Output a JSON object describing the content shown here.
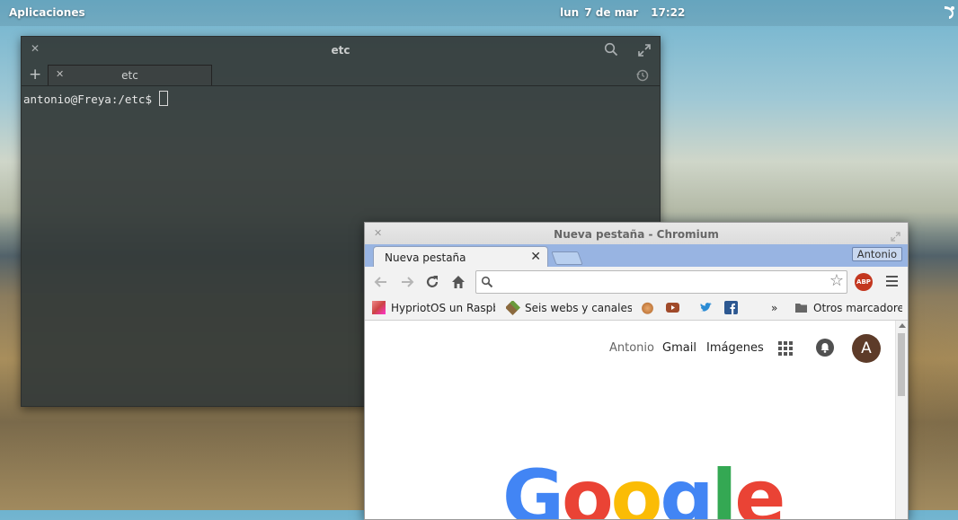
{
  "panel": {
    "applications_label": "Aplicaciones",
    "day": "lun",
    "date": "7 de mar",
    "time": "17:22"
  },
  "terminal": {
    "title": "etc",
    "tab_label": "etc",
    "prompt": "antonio@Freya:/etc$"
  },
  "chromium": {
    "window_title": "Nueva pestaña - Chromium",
    "tab_label": "Nueva pestaña",
    "profile_label": "Antonio",
    "omnibox_value": "",
    "abp_label": "ABP",
    "bookmarks": [
      {
        "label": "HypriotOS un Raspbia",
        "icon": "hypriot-favicon"
      },
      {
        "label": "Seis webs y canales de",
        "icon": "minecraft-favicon"
      },
      {
        "label": "",
        "icon": "reddit-favicon"
      },
      {
        "label": "",
        "icon": "youtube-icon"
      },
      {
        "label": "",
        "icon": "twitter-icon"
      },
      {
        "label": "",
        "icon": "facebook-icon"
      }
    ],
    "overflow_label": "»",
    "other_bookmarks_label": "Otros marcadores",
    "google_header": {
      "user_link": "Antonio",
      "gmail_link": "Gmail",
      "images_link": "Imágenes",
      "avatar_letter": "A"
    },
    "logo_text": "Google",
    "colors": {
      "tabstrip": "#98b4e2",
      "abp": "#c3371f",
      "avatar": "#5d3b29",
      "logo_blue": "#4285f4",
      "logo_red": "#ea4335",
      "logo_yellow": "#fbbc05",
      "logo_green": "#34a853"
    }
  }
}
